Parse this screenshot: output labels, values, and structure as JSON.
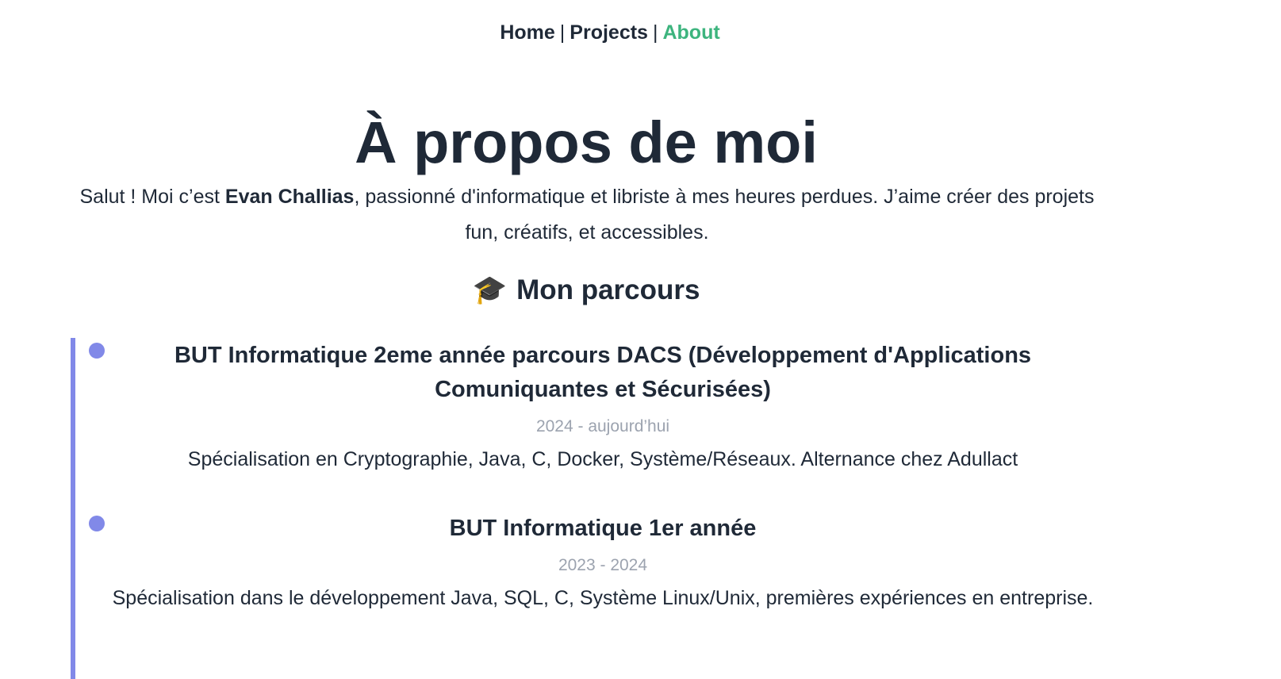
{
  "nav": {
    "items": [
      {
        "label": "Home"
      },
      {
        "label": "Projects"
      },
      {
        "label": "About"
      }
    ],
    "separator": "|",
    "active_color": "#3db47e"
  },
  "page_title": "À propos de moi",
  "intro": {
    "before": "Salut ! Moi c’est ",
    "name": "Evan Challias",
    "after": ", passionné d'informatique et libriste à mes heures perdues. J’aime créer des projets fun, créatifs, et accessibles."
  },
  "section": {
    "icon": "🎓",
    "icon_name": "graduation-cap-icon",
    "title": "Mon parcours"
  },
  "timeline": {
    "accent_color": "#8189e8",
    "entries": [
      {
        "title": "BUT Informatique 2eme année parcours DACS (Développement d'Applications Comuniquantes et Sécurisées)",
        "date": "2024 - aujourd’hui",
        "description": "Spécialisation en Cryptographie, Java, C, Docker, Système/Réseaux. Alternance chez Adullact"
      },
      {
        "title": "BUT Informatique 1er année",
        "date": "2023 - 2024",
        "description": "Spécialisation dans le développement Java, SQL, C, Système Linux/Unix, premières expériences en entreprise."
      }
    ]
  }
}
